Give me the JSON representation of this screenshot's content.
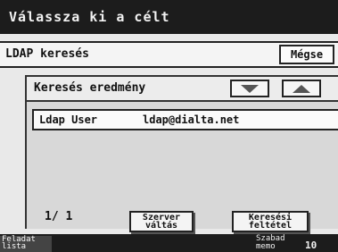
{
  "title": "Válassza ki a célt",
  "header": {
    "label": "LDAP keresés",
    "cancel_label": "Mégse"
  },
  "results": {
    "title": "Keresés eredmény",
    "rows": [
      {
        "name": "Ldap User",
        "email": "ldap@dialta.net"
      }
    ],
    "page_indicator": "1/ 1",
    "server_button": {
      "line1": "Szerver",
      "line2": "váltás"
    },
    "criteria_button": {
      "line1": "Keresési",
      "line2": "feltétel"
    }
  },
  "footer": {
    "tab_line1": "Feladat",
    "tab_line2": "lista",
    "status_line1": "Szabad",
    "status_line2": "memo",
    "status_value": "10"
  },
  "icons": {
    "scroll_down": "triangle-down-icon",
    "scroll_up": "triangle-up-icon"
  }
}
